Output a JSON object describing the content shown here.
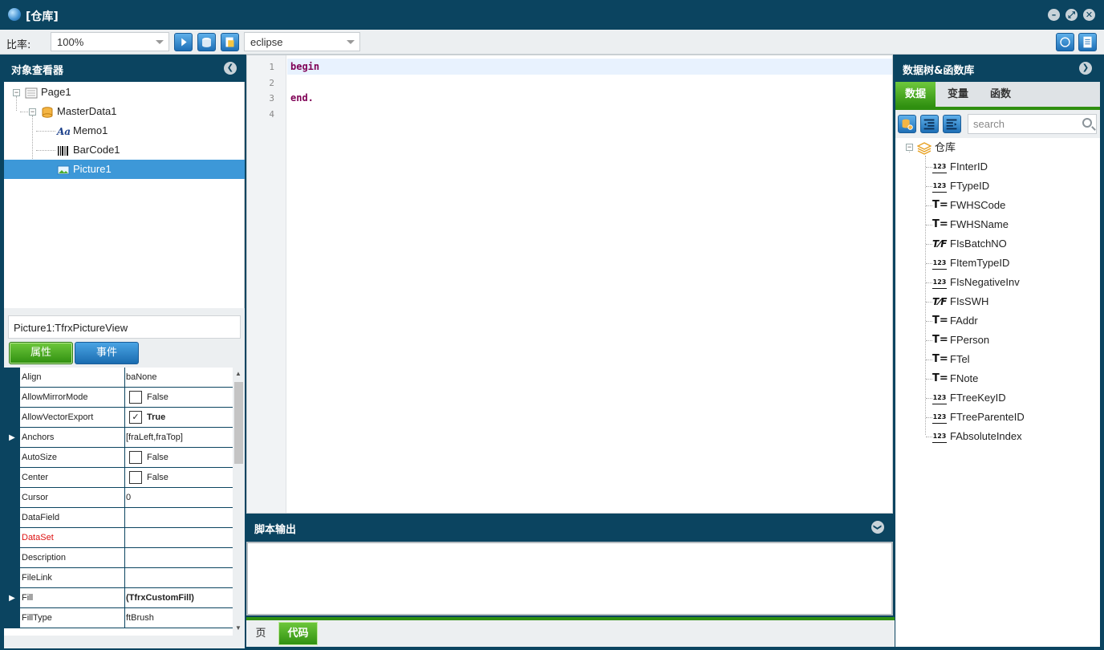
{
  "window": {
    "title": "[仓库]"
  },
  "toolbar": {
    "ratio_label": "比率:",
    "zoom_value": "100%",
    "theme_value": "eclipse"
  },
  "object_inspector": {
    "title": "对象查看器",
    "tree": [
      {
        "label": "Page1",
        "icon": "page-icon"
      },
      {
        "label": "MasterData1",
        "icon": "database-icon"
      },
      {
        "label": "Memo1",
        "icon": "text-icon"
      },
      {
        "label": "BarCode1",
        "icon": "barcode-icon"
      },
      {
        "label": "Picture1",
        "icon": "picture-icon",
        "selected": true
      }
    ],
    "selected_object": "Picture1:TfrxPictureView",
    "tab_props": "属性",
    "tab_events": "事件",
    "properties": [
      {
        "name": "Align",
        "value": "baNone"
      },
      {
        "name": "AllowMirrorMode",
        "value": "False",
        "checkbox": true,
        "checked": false
      },
      {
        "name": "AllowVectorExport",
        "value": "True",
        "checkbox": true,
        "checked": true
      },
      {
        "name": "Anchors",
        "value": "[fraLeft,fraTop]",
        "expandable": true
      },
      {
        "name": "AutoSize",
        "value": "False",
        "checkbox": true,
        "checked": false
      },
      {
        "name": "Center",
        "value": "False",
        "checkbox": true,
        "checked": false
      },
      {
        "name": "Cursor",
        "value": "0"
      },
      {
        "name": "DataField",
        "value": ""
      },
      {
        "name": "DataSet",
        "value": "",
        "highlight": true
      },
      {
        "name": "Description",
        "value": ""
      },
      {
        "name": "FileLink",
        "value": ""
      },
      {
        "name": "Fill",
        "value": "(TfrxCustomFill)",
        "expandable": true
      },
      {
        "name": "FillType",
        "value": "ftBrush"
      }
    ]
  },
  "editor": {
    "lines": [
      {
        "num": "1",
        "text": "begin"
      },
      {
        "num": "2",
        "text": ""
      },
      {
        "num": "3",
        "text": "end."
      },
      {
        "num": "4",
        "text": ""
      }
    ]
  },
  "script_output": {
    "title": "脚本输出"
  },
  "bottom_tabs": {
    "page": "页",
    "code": "代码"
  },
  "data_panel": {
    "title": "数据树&函数库",
    "tabs": [
      "数据",
      "变量",
      "函数"
    ],
    "search_placeholder": "search",
    "root": "仓库",
    "fields": [
      {
        "name": "FInterID",
        "type": "number"
      },
      {
        "name": "FTypeID",
        "type": "number"
      },
      {
        "name": "FWHSCode",
        "type": "text"
      },
      {
        "name": "FWHSName",
        "type": "text"
      },
      {
        "name": "FIsBatchNO",
        "type": "bool"
      },
      {
        "name": "FItemTypeID",
        "type": "number"
      },
      {
        "name": "FIsNegativeInv",
        "type": "number"
      },
      {
        "name": "FIsSWH",
        "type": "bool"
      },
      {
        "name": "FAddr",
        "type": "text"
      },
      {
        "name": "FPerson",
        "type": "text"
      },
      {
        "name": "FTel",
        "type": "text"
      },
      {
        "name": "FNote",
        "type": "text"
      },
      {
        "name": "FTreeKeyID",
        "type": "number"
      },
      {
        "name": "FTreeParenteID",
        "type": "number"
      },
      {
        "name": "FAbsoluteIndex",
        "type": "number"
      }
    ]
  }
}
